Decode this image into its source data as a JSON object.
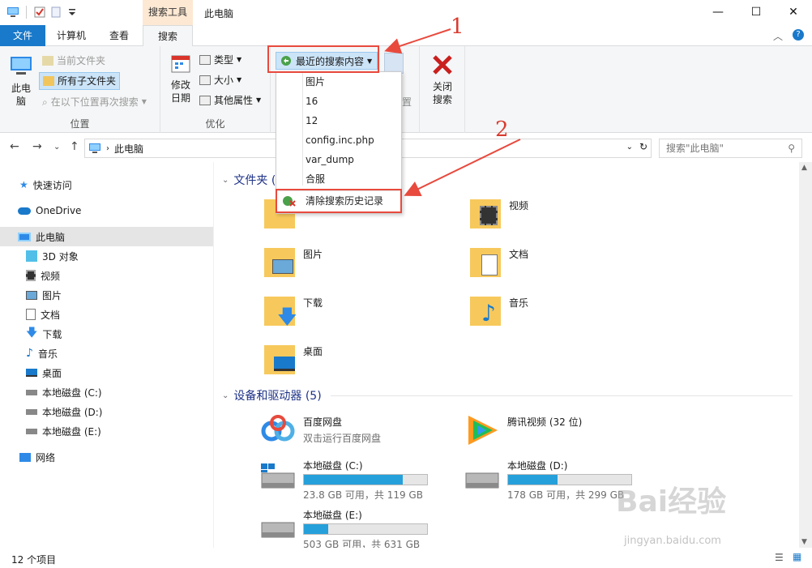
{
  "window": {
    "title": "此电脑",
    "context_tab": "搜索工具",
    "minimize": "—",
    "maximize": "☐",
    "close": "✕"
  },
  "tabs": {
    "file": "文件",
    "computer": "计算机",
    "view": "查看",
    "search": "搜索"
  },
  "ribbon": {
    "location": {
      "this_pc_label": "此电\n脑",
      "current_folder": "当前文件夹",
      "all_subfolders": "所有子文件夹",
      "search_again": "在以下位置再次搜索",
      "group_label": "位置"
    },
    "refine": {
      "date_modified": "修改\n日期",
      "kind": "类型",
      "size": "大小",
      "other_props": "其他属性",
      "group_label": "优化"
    },
    "options": {
      "recent_searches": "最近的搜索内容",
      "partial_label_1": "置"
    },
    "close": {
      "label": "关闭\n搜索"
    }
  },
  "dropdown": {
    "items": [
      "图片",
      "16",
      "12",
      "config.inc.php",
      "var_dump",
      "合服"
    ],
    "clear_history": "清除搜索历史记录"
  },
  "address": {
    "path": "此电脑",
    "search_placeholder": "搜索\"此电脑\""
  },
  "navpane": {
    "quick_access": "快速访问",
    "onedrive": "OneDrive",
    "this_pc": "此电脑",
    "objects3d": "3D 对象",
    "videos": "视频",
    "pictures": "图片",
    "documents": "文档",
    "downloads": "下载",
    "music": "音乐",
    "desktop": "桌面",
    "drive_c": "本地磁盘 (C:)",
    "drive_d": "本地磁盘 (D:)",
    "drive_e": "本地磁盘 (E:)",
    "network": "网络"
  },
  "content": {
    "folders_header": "文件夹 (",
    "folders": {
      "videos": "视频",
      "pictures": "图片",
      "documents": "文档",
      "downloads": "下载",
      "music": "音乐",
      "desktop": "桌面"
    },
    "devices_header": "设备和驱动器 (5)",
    "devices": {
      "baidu_name": "百度网盘",
      "baidu_sub": "双击运行百度网盘",
      "tencent_name": "腾讯视频 (32 位)",
      "c_name": "本地磁盘 (C:)",
      "c_sub": "23.8 GB 可用，共 119 GB",
      "c_used": 0.8,
      "d_name": "本地磁盘 (D:)",
      "d_sub": "178 GB 可用，共 299 GB",
      "d_used": 0.4,
      "e_name": "本地磁盘 (E:)",
      "e_sub": "503 GB 可用，共 631 GB",
      "e_used": 0.2
    }
  },
  "status": {
    "count": "12 个项目"
  },
  "annotations": {
    "n1": "1",
    "n2": "2"
  },
  "watermark": {
    "logo": "Bai经验",
    "url": "jingyan.baidu.com"
  },
  "colors": {
    "accent": "#1979ca",
    "highlight": "#cce4f7",
    "annotation_red": "#e84a3e",
    "drive_fill": "#26a0da"
  }
}
